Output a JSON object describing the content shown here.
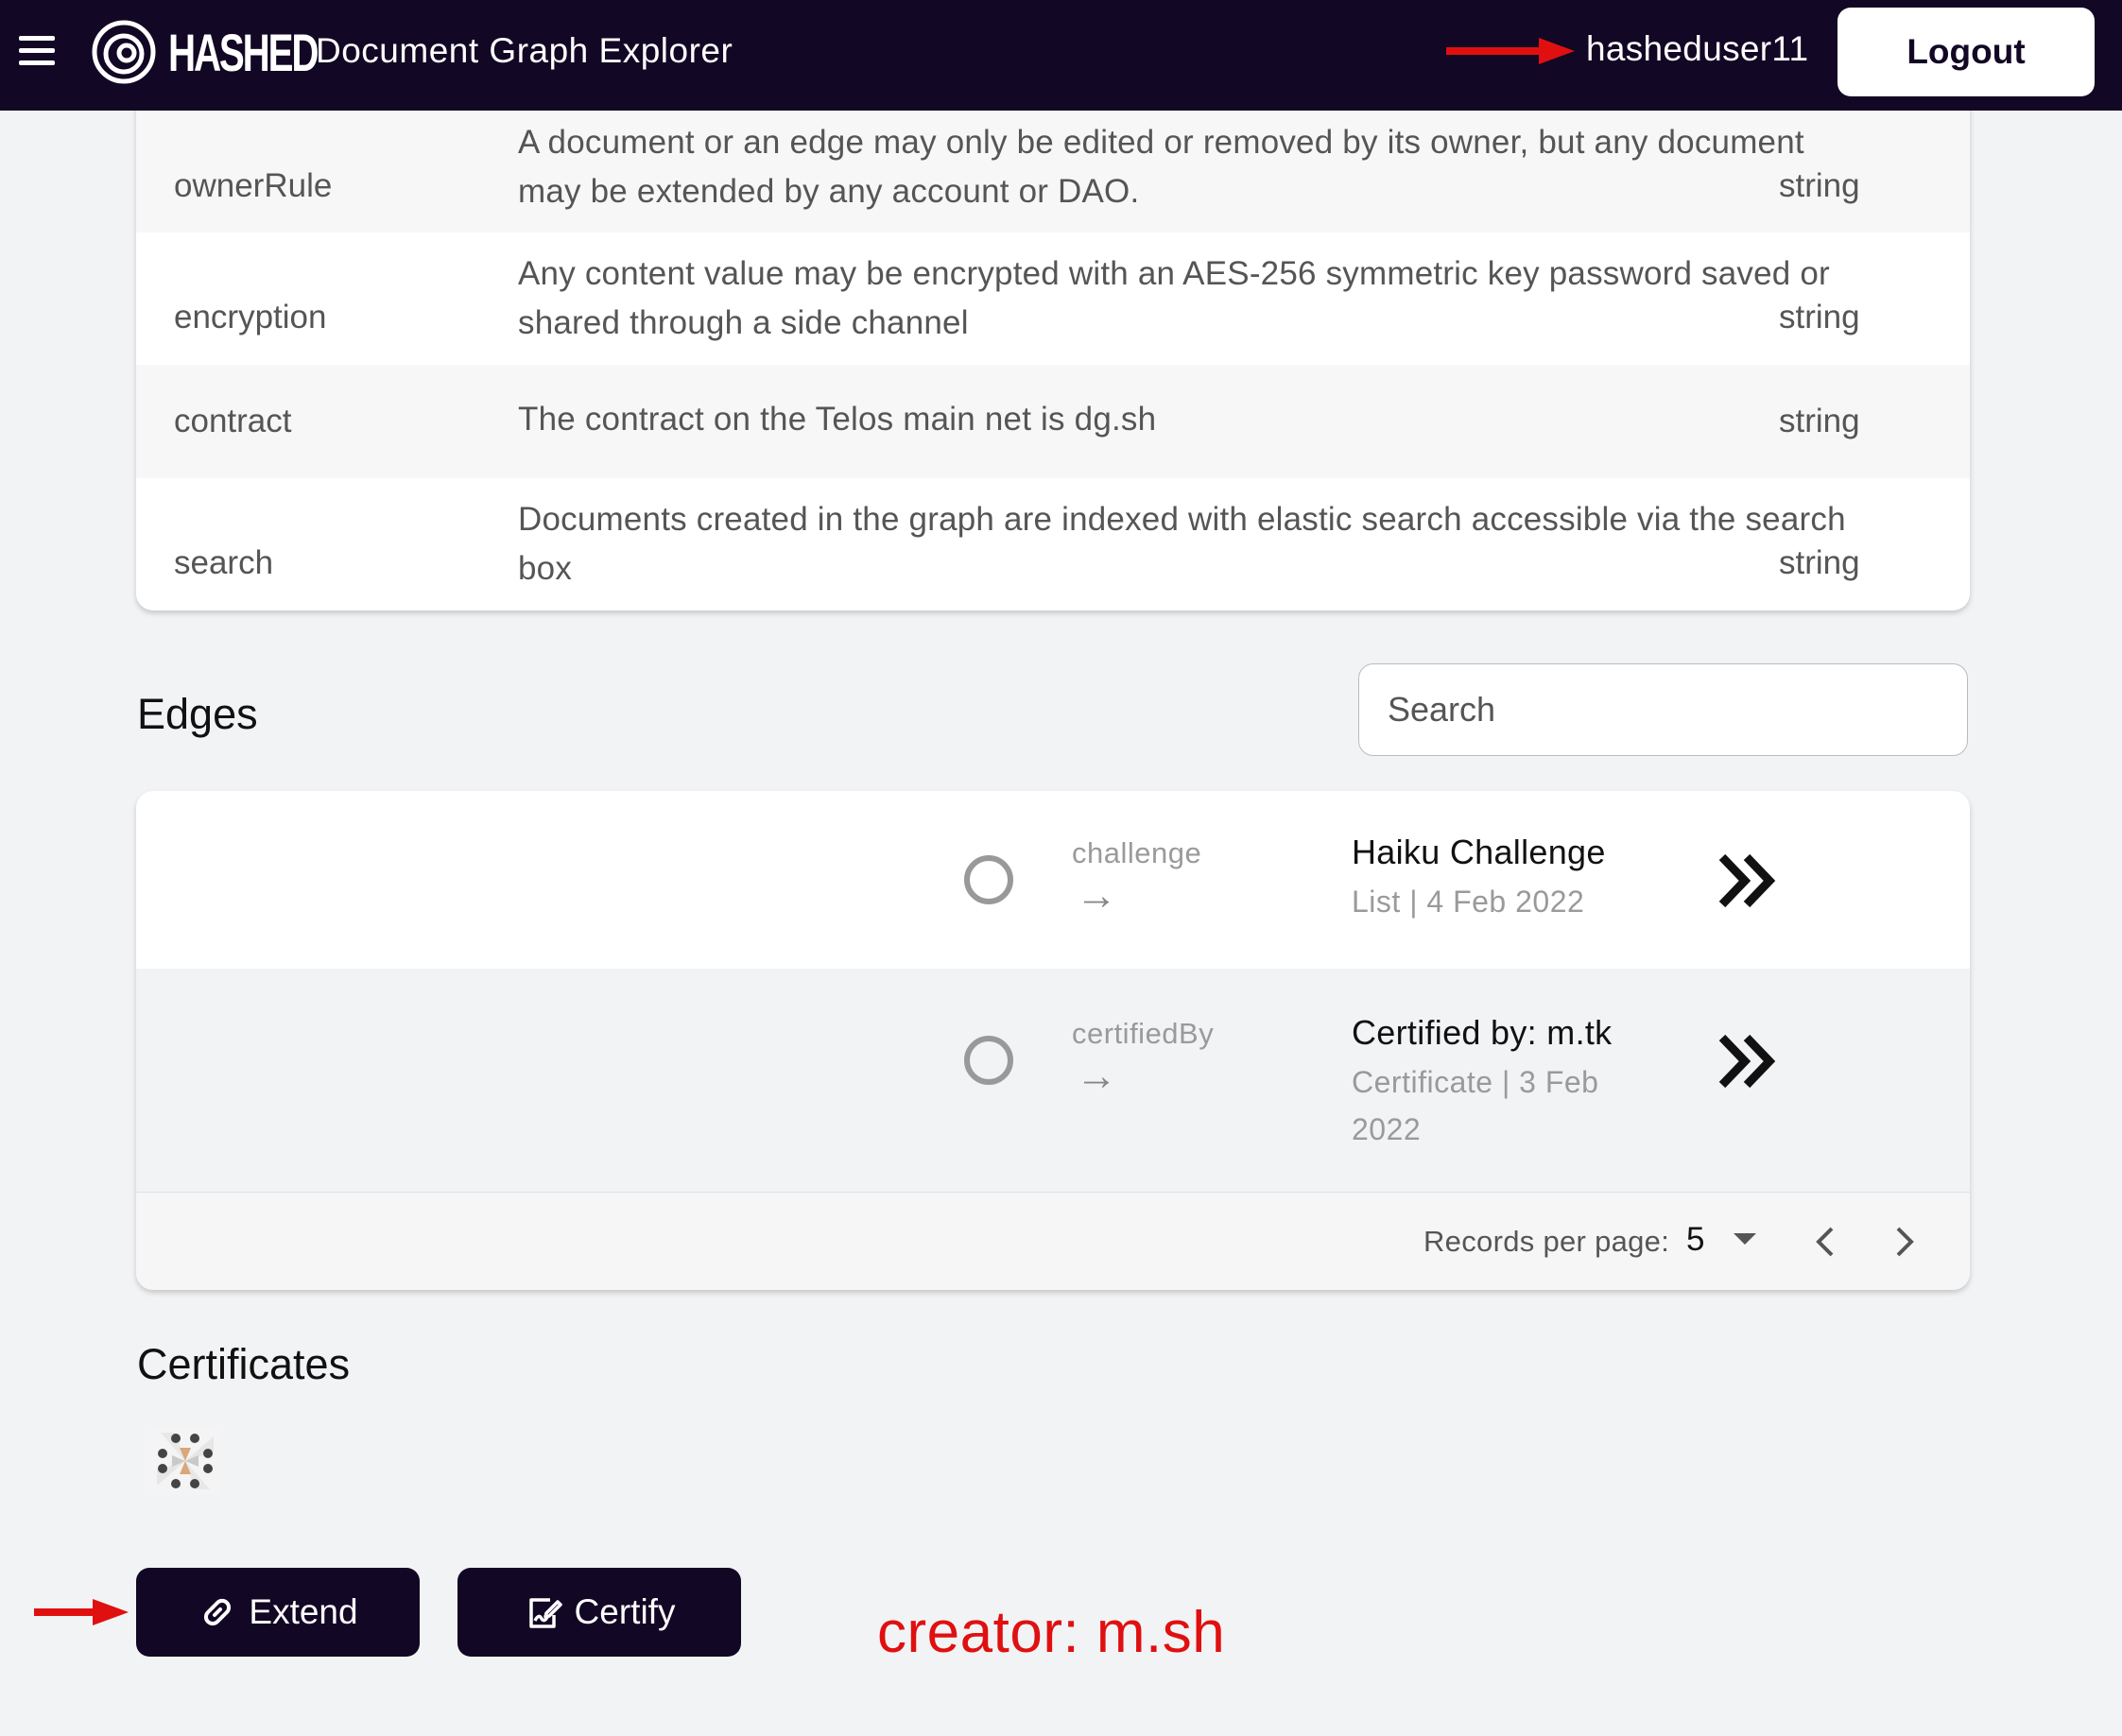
{
  "header": {
    "brand": "HASHED",
    "app_title": "Document Graph Explorer",
    "username": "hasheduser11",
    "logout_label": "Logout"
  },
  "properties": [
    {
      "name": "ownerRule",
      "description": "A document or an edge may only be edited or removed by its owner, but any document may be extended by any account or DAO.",
      "type": "string"
    },
    {
      "name": "encryption",
      "description": "Any content value may be encrypted with an AES-256 symmetric key password saved or shared through a side channel",
      "type": "string"
    },
    {
      "name": "contract",
      "description": "The contract on the Telos main net is dg.sh",
      "type": "string"
    },
    {
      "name": "search",
      "description": "Documents created in the graph are indexed with elastic search accessible via the search box",
      "type": "string"
    }
  ],
  "edges": {
    "title": "Edges",
    "search_placeholder": "Search",
    "rows": [
      {
        "edge_name": "challenge",
        "title": "Haiku Challenge",
        "meta": "List | 4 Feb 2022"
      },
      {
        "edge_name": "certifiedBy",
        "title": "Certified by: m.tk",
        "meta": "Certificate | 3 Feb 2022"
      }
    ],
    "pagination": {
      "records_per_page_label": "Records per page:",
      "records_per_page": "5"
    }
  },
  "certificates": {
    "title": "Certificates"
  },
  "actions": {
    "extend_label": "Extend",
    "certify_label": "Certify"
  },
  "annotation": {
    "text": "creator: m.sh",
    "color": "#e01010"
  },
  "colors": {
    "navbar": "#120724",
    "annotation_arrow": "#e01010"
  }
}
